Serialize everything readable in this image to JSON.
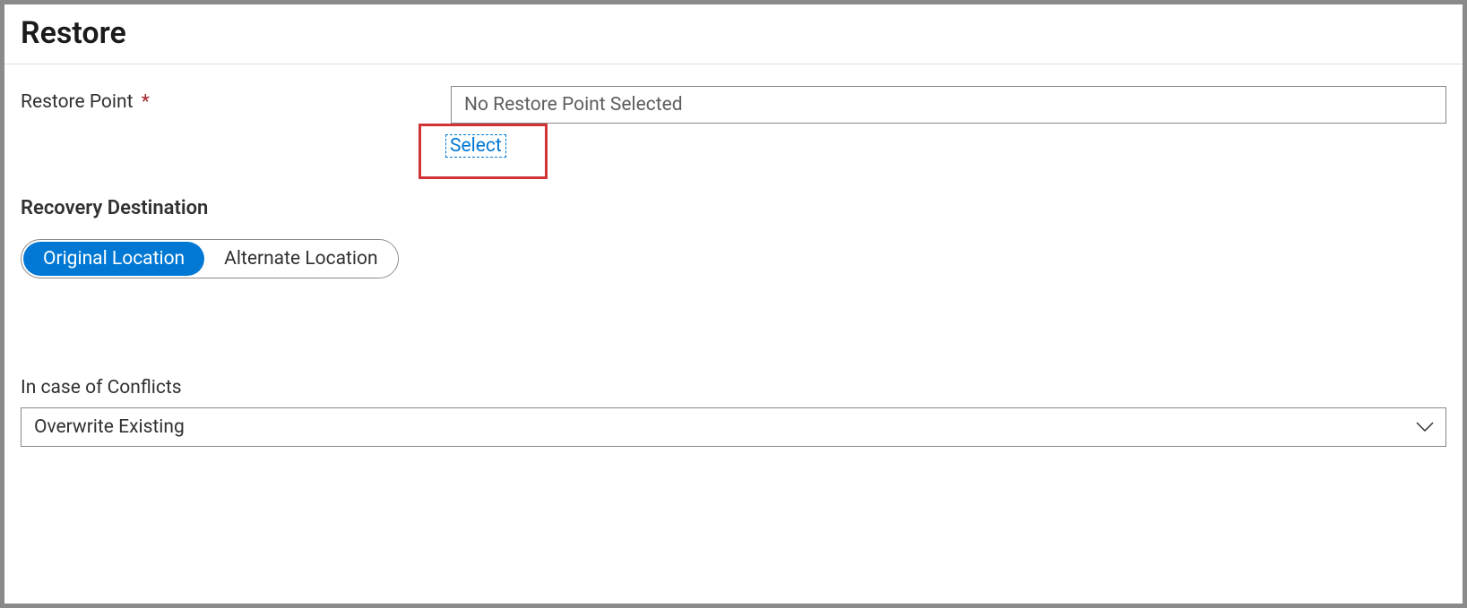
{
  "page": {
    "title": "Restore"
  },
  "restorePoint": {
    "label": "Restore Point",
    "requiredMark": "*",
    "value": "No Restore Point Selected",
    "selectLink": "Select"
  },
  "recoveryDestination": {
    "label": "Recovery Destination",
    "options": {
      "original": "Original Location",
      "alternate": "Alternate Location"
    },
    "selected": "original"
  },
  "conflicts": {
    "label": "In case of Conflicts",
    "value": "Overwrite Existing"
  }
}
